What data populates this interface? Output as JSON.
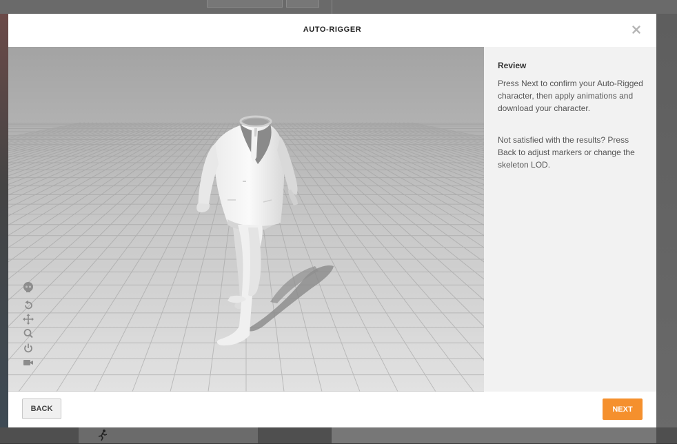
{
  "modal": {
    "title": "AUTO-RIGGER",
    "close_icon": "close-icon"
  },
  "viewport": {
    "tools": [
      {
        "icon": "skull-icon"
      },
      {
        "icon": "rotate-icon"
      },
      {
        "icon": "move-icon"
      },
      {
        "icon": "zoom-icon"
      },
      {
        "icon": "power-icon"
      },
      {
        "icon": "camera-icon"
      }
    ]
  },
  "sidebar": {
    "heading": "Review",
    "paragraph1": "Press Next to confirm your Auto-Rigged character, then apply animations and download your character.",
    "paragraph2": "Not satisfied with the results? Press Back to adjust markers or change the skeleton LOD."
  },
  "footer": {
    "back_label": "BACK",
    "next_label": "NEXT"
  },
  "colors": {
    "accent": "#f5902d",
    "sidebar_bg": "#f2f2f2"
  }
}
